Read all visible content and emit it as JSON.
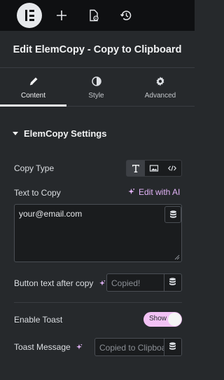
{
  "topbar": {
    "logo_icon": "elementor-logo-icon",
    "icons": [
      "plus-icon",
      "page-settings-icon",
      "history-icon"
    ]
  },
  "panel": {
    "title": "Edit ElemCopy - Copy to Clipboard"
  },
  "tabs": [
    {
      "label": "Content",
      "icon": "pencil-icon",
      "active": true
    },
    {
      "label": "Style",
      "icon": "contrast-icon",
      "active": false
    },
    {
      "label": "Advanced",
      "icon": "gear-icon",
      "active": false
    }
  ],
  "section": {
    "title": "ElemCopy Settings"
  },
  "fields": {
    "copy_type": {
      "label": "Copy Type",
      "options": [
        "text-icon",
        "image-icon",
        "code-icon"
      ],
      "selected": "text-icon"
    },
    "text_to_copy": {
      "label": "Text to Copy",
      "ai_label": "Edit with AI",
      "value": "your@email.com"
    },
    "button_text_after_copy": {
      "label": "Button text after copy",
      "placeholder": "Copied!"
    },
    "enable_toast": {
      "label": "Enable Toast",
      "toggle_label": "Show",
      "on": true
    },
    "toast_message": {
      "label": "Toast Message",
      "placeholder": "Copied to Clipboard"
    }
  },
  "colors": {
    "accent_ai": "#e2b3f7",
    "toggle_on": "#f2c2f5",
    "panel_bg": "#26292c",
    "topbar_bg": "#0f1012"
  }
}
